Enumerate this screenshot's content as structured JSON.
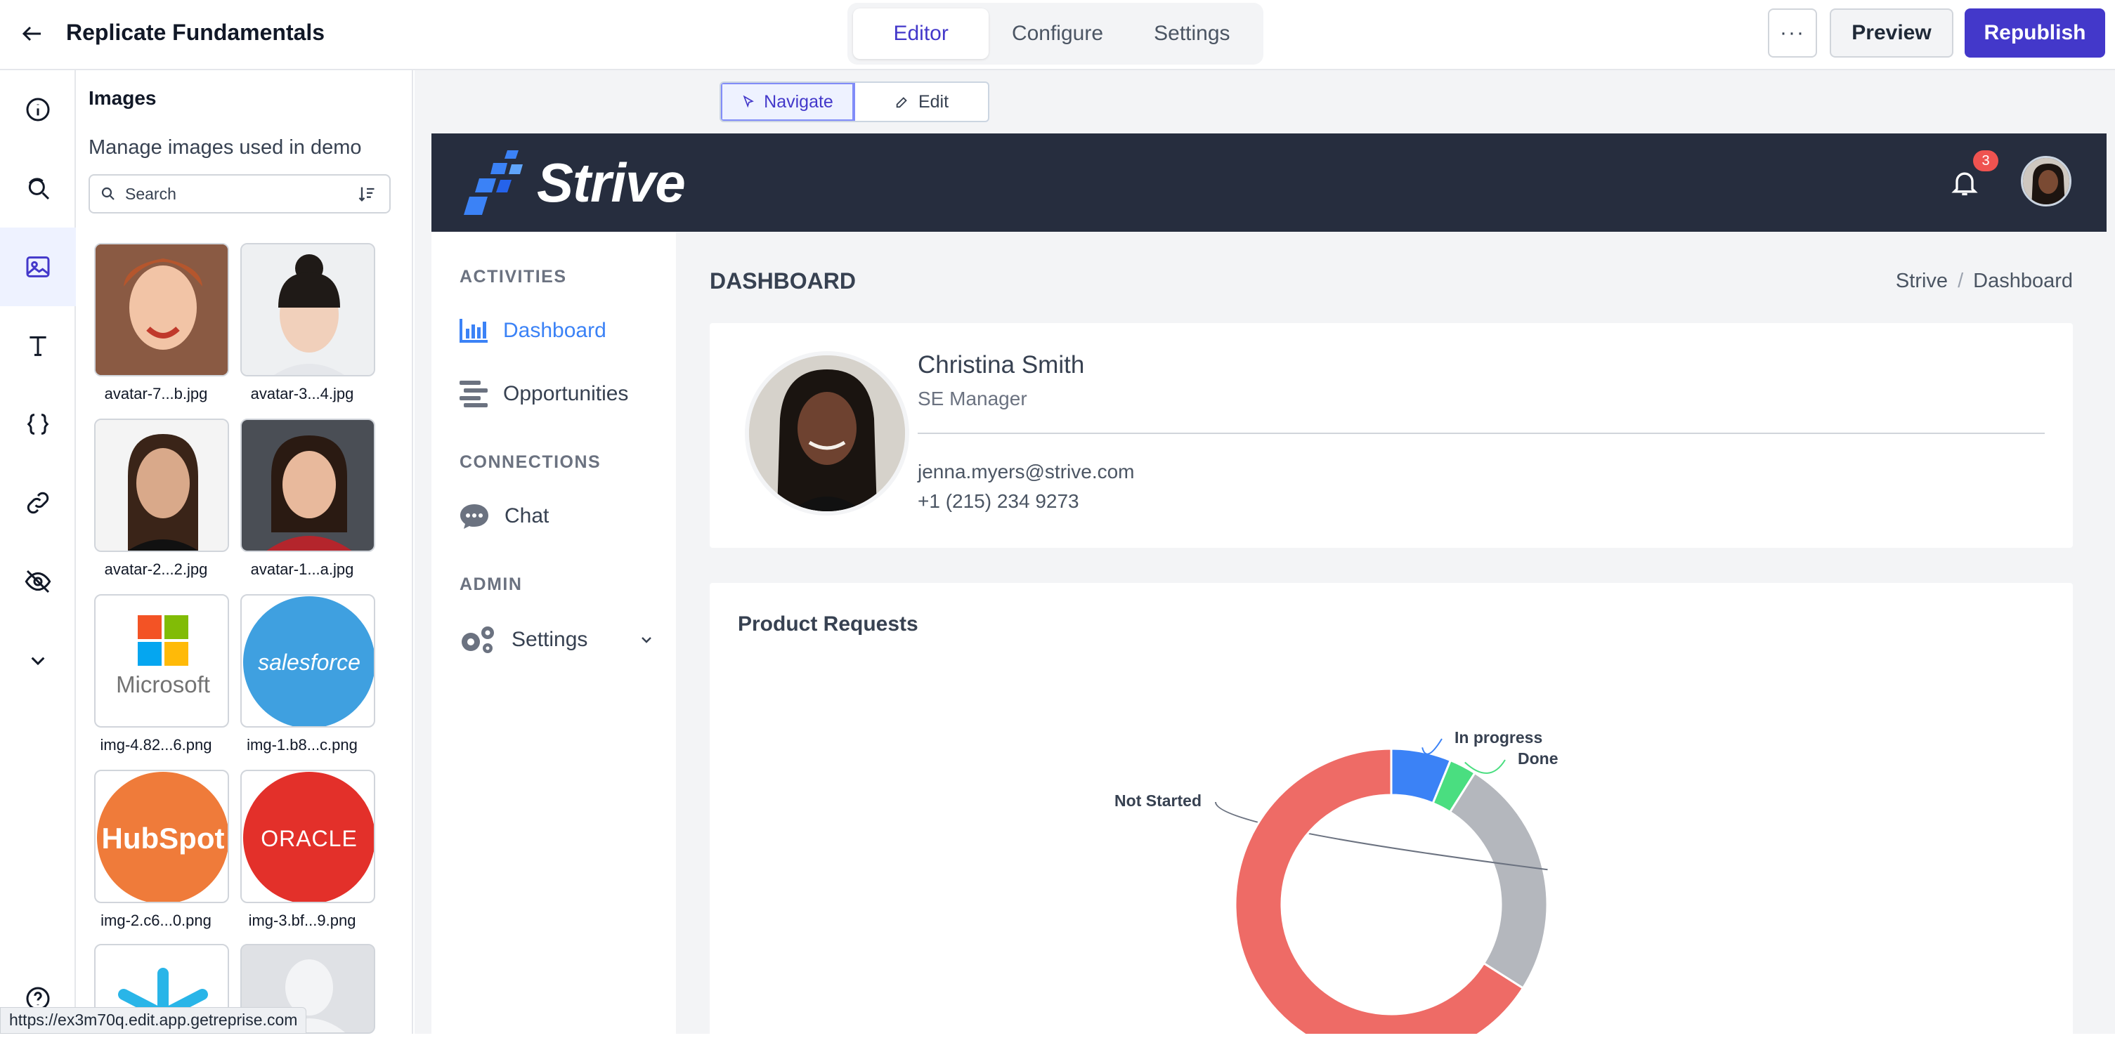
{
  "topbar": {
    "title": "Replicate Fundamentals",
    "tabs": [
      {
        "label": "Editor",
        "active": true
      },
      {
        "label": "Configure"
      },
      {
        "label": "Settings"
      }
    ],
    "more_label": "···",
    "preview_label": "Preview",
    "republish_label": "Republish"
  },
  "rail": {
    "items": [
      "info-icon",
      "search-refresh-icon",
      "image-icon",
      "text-icon",
      "code-braces-icon",
      "link-icon",
      "eye-off-icon",
      "chevron-down-icon",
      "help-icon"
    ]
  },
  "images_panel": {
    "title": "Images",
    "subtitle": "Manage images used in demo",
    "search_placeholder": "Search",
    "items": [
      {
        "caption": "avatar-7...b.jpg"
      },
      {
        "caption": "avatar-3...4.jpg"
      },
      {
        "caption": "avatar-2...2.jpg"
      },
      {
        "caption": "avatar-1...a.jpg"
      },
      {
        "caption": "img-4.82...6.png",
        "logo": "Microsoft"
      },
      {
        "caption": "img-1.b8...c.png",
        "logo": "salesforce"
      },
      {
        "caption": "img-2.c6...0.png",
        "logo": "HubSpot"
      },
      {
        "caption": "img-3.bf...9.png",
        "logo": "ORACLE"
      }
    ]
  },
  "status_url": "https://ex3m70q.edit.app.getreprise.com",
  "mode_toggle": {
    "navigate": "Navigate",
    "edit": "Edit"
  },
  "demo": {
    "brand": "Strive",
    "notification_count": "3",
    "nav": {
      "sections": [
        {
          "label": "ACTIVITIES",
          "items": [
            {
              "label": "Dashboard",
              "active": true
            },
            {
              "label": "Opportunities"
            }
          ]
        },
        {
          "label": "CONNECTIONS",
          "items": [
            {
              "label": "Chat"
            }
          ]
        },
        {
          "label": "ADMIN",
          "items": [
            {
              "label": "Settings"
            }
          ]
        }
      ]
    },
    "page_title": "DASHBOARD",
    "breadcrumb": [
      "Strive",
      "/",
      "Dashboard"
    ],
    "profile": {
      "name": "Christina Smith",
      "role": "SE Manager",
      "email": "jenna.myers@strive.com",
      "phone": "+1 (215) 234 9273"
    },
    "chart_title": "Product Requests"
  },
  "colors": {
    "accent": "#4338ca",
    "dark_header": "#262d3e",
    "link_blue": "#3b82f6"
  },
  "chart_data": {
    "type": "pie",
    "title": "Product Requests",
    "categories": [
      "In progress",
      "Done",
      "Not Started",
      ""
    ],
    "values": [
      6.2,
      2.8,
      25,
      66
    ],
    "colors": [
      "#3b82f6",
      "#4ade80",
      "#b4b7bd",
      "#ee6b66"
    ],
    "donut": true
  }
}
